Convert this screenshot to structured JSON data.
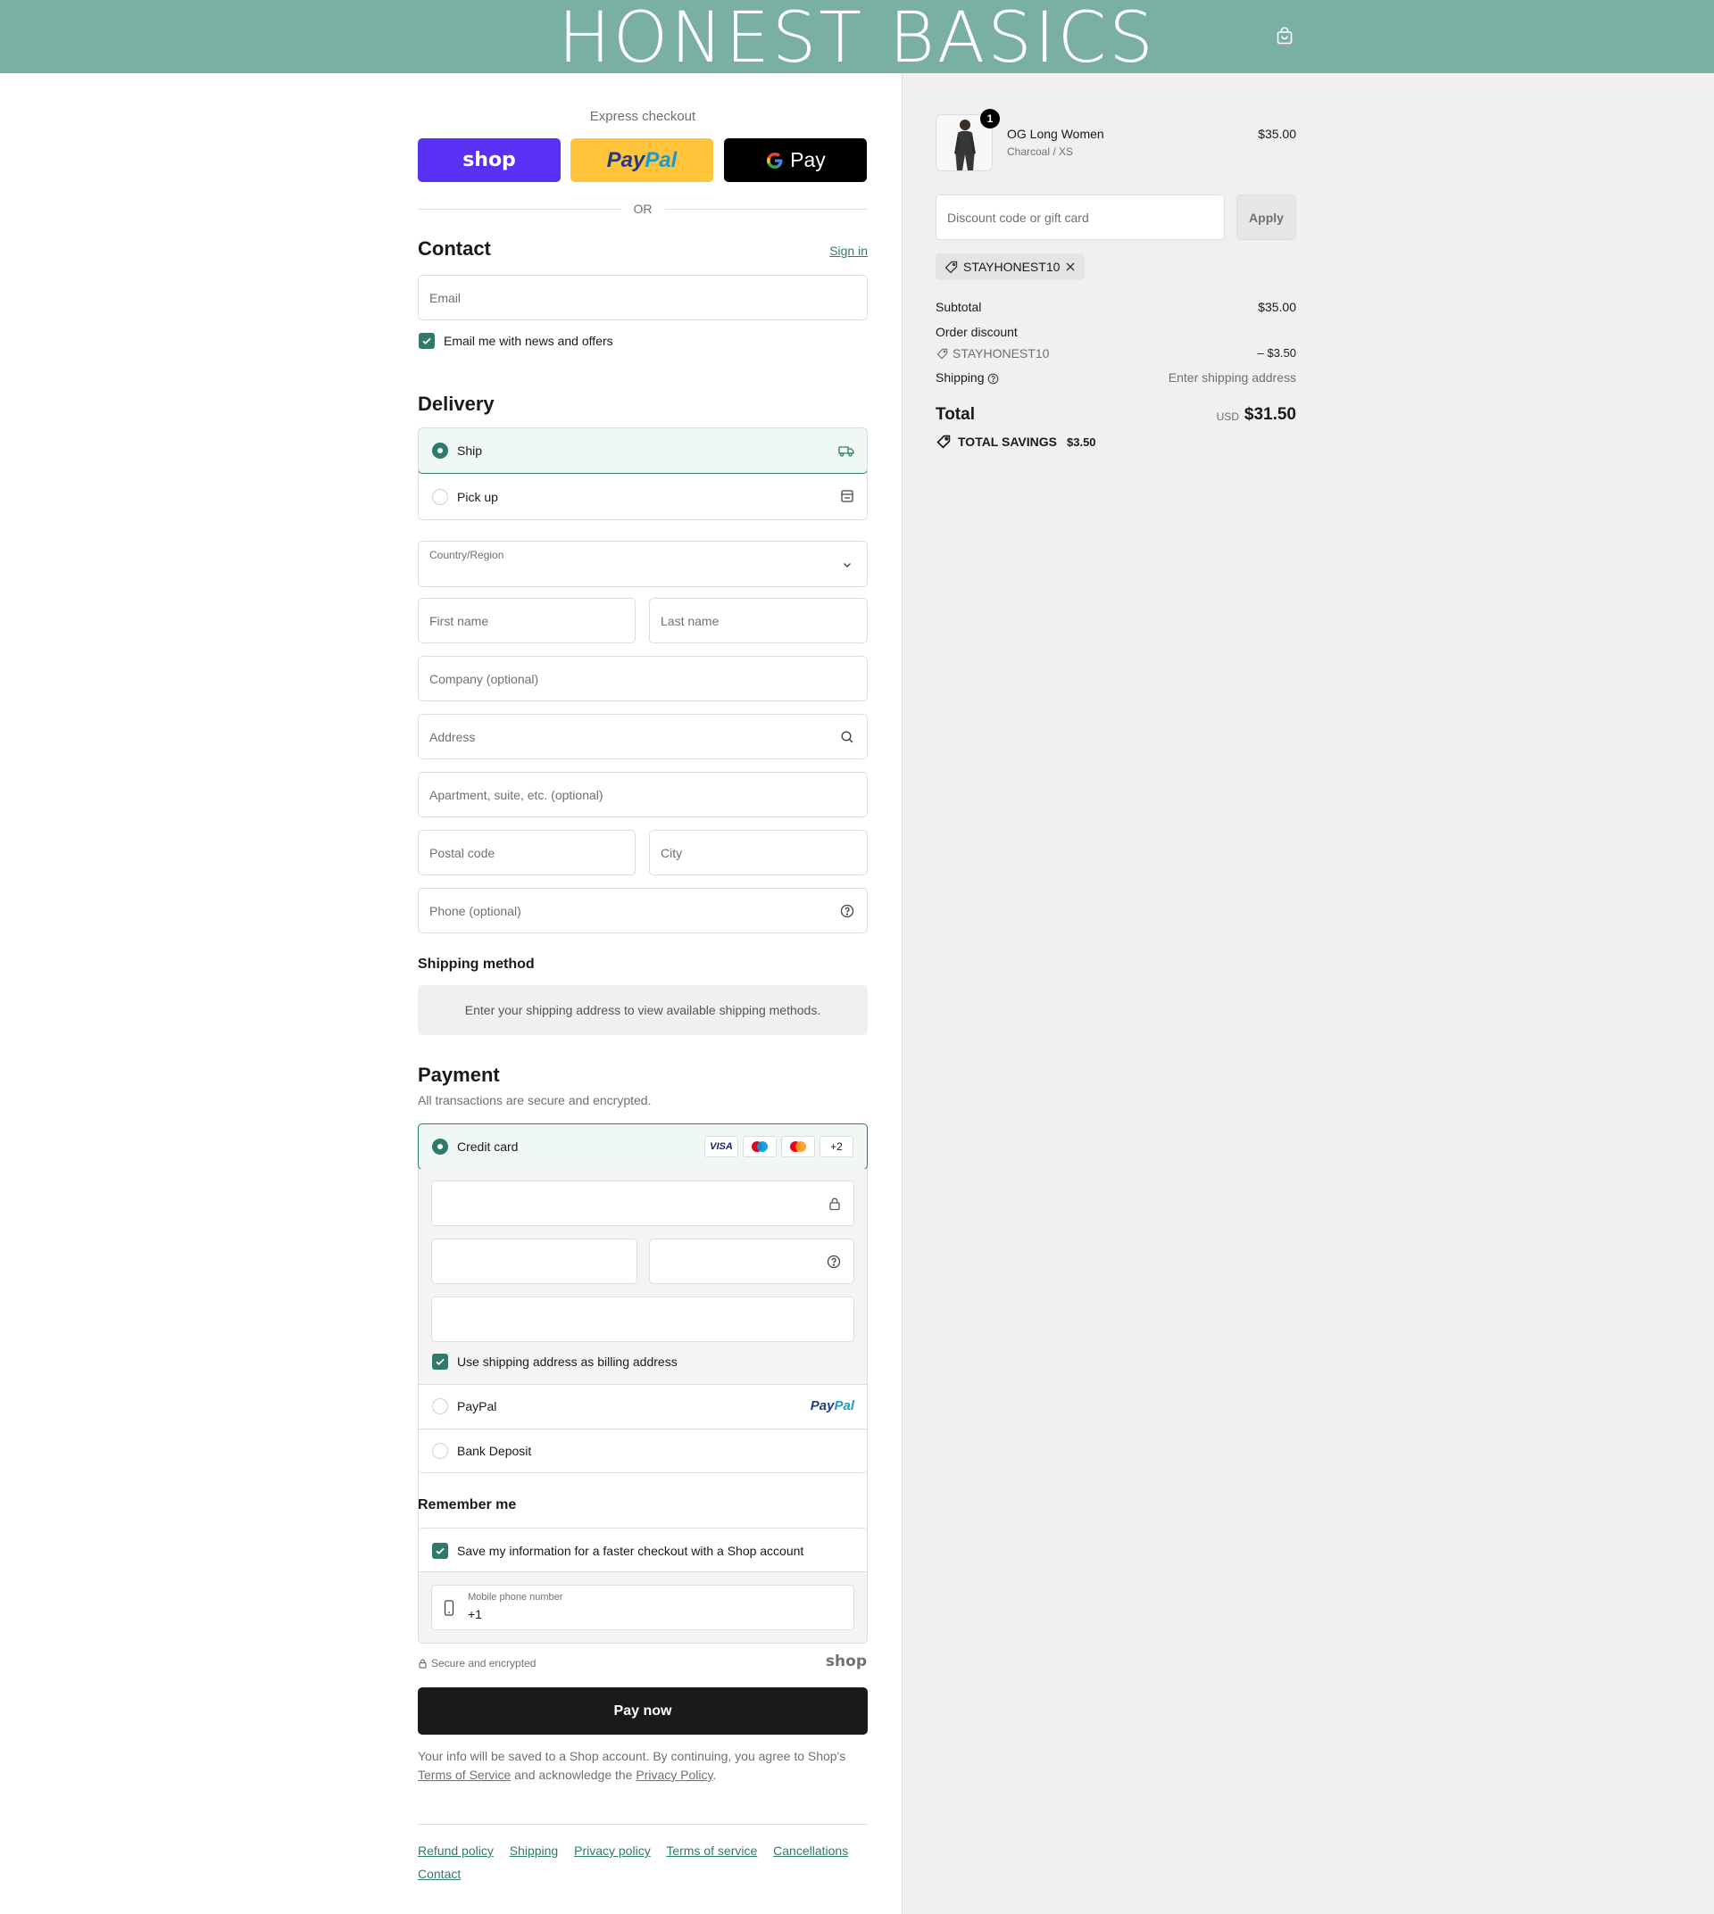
{
  "brand": {
    "name": "HONEST BASICS"
  },
  "colors": {
    "header": "#7ab0a3",
    "accent": "#2f7a6a",
    "shop": "#5a31f4",
    "paypal": "#ffc439",
    "gpay": "#000000"
  },
  "express": {
    "title": "Express checkout",
    "shop_label": "shop",
    "paypal_a": "Pay",
    "paypal_b": "Pal",
    "gpay_label": "Pay",
    "or": "OR"
  },
  "contact": {
    "title": "Contact",
    "sign_in": "Sign in",
    "email_placeholder": "Email",
    "news_label": "Email me with news and offers"
  },
  "delivery": {
    "title": "Delivery",
    "options": [
      {
        "label": "Ship",
        "icon": "truck-icon",
        "selected": true
      },
      {
        "label": "Pick up",
        "icon": "store-icon",
        "selected": false
      }
    ],
    "country_label": "Country/Region",
    "first_name": "First name",
    "last_name": "Last name",
    "company": "Company (optional)",
    "address": "Address",
    "apartment": "Apartment, suite, etc. (optional)",
    "postal": "Postal code",
    "city": "City",
    "phone": "Phone (optional)"
  },
  "shipping_method": {
    "title": "Shipping method",
    "message": "Enter your shipping address to view available shipping methods."
  },
  "payment": {
    "title": "Payment",
    "subtitle": "All transactions are secure and encrypted.",
    "credit_card": "Credit card",
    "card_logos": [
      "VISA",
      "maestro",
      "mastercard"
    ],
    "more_cards": "+2",
    "billing_label": "Use shipping address as billing address",
    "paypal": "PayPal",
    "paypal_logo_a": "Pay",
    "paypal_logo_b": "Pal",
    "bank": "Bank Deposit"
  },
  "remember": {
    "title": "Remember me",
    "save_label": "Save my information for a faster checkout with a Shop account",
    "phone_label": "Mobile phone number",
    "phone_prefix": "+1",
    "secure": "Secure and encrypted",
    "shop_logo": "shop"
  },
  "pay_now": "Pay now",
  "legal": {
    "text1": "Your info will be saved to a Shop account. By continuing, you agree to Shop's",
    "terms": "Terms of Service",
    "text2": "and acknowledge the",
    "privacy": "Privacy Policy",
    "text3": "."
  },
  "footer": {
    "links": [
      "Refund policy",
      "Shipping",
      "Privacy policy",
      "Terms of service",
      "Cancellations",
      "Contact"
    ]
  },
  "summary": {
    "item": {
      "name": "OG Long Women",
      "variant": "Charcoal / XS",
      "price": "$35.00",
      "quantity": "1"
    },
    "discount_placeholder": "Discount code or gift card",
    "apply": "Apply",
    "code": "STAYHONEST10",
    "subtotal_label": "Subtotal",
    "subtotal": "$35.00",
    "order_discount_label": "Order discount",
    "discount_code": "STAYHONEST10",
    "discount_value": "– $3.50",
    "shipping_label": "Shipping",
    "shipping_value": "Enter shipping address",
    "total_label": "Total",
    "currency": "USD",
    "total": "$31.50",
    "savings_label": "TOTAL SAVINGS",
    "savings": "$3.50"
  }
}
